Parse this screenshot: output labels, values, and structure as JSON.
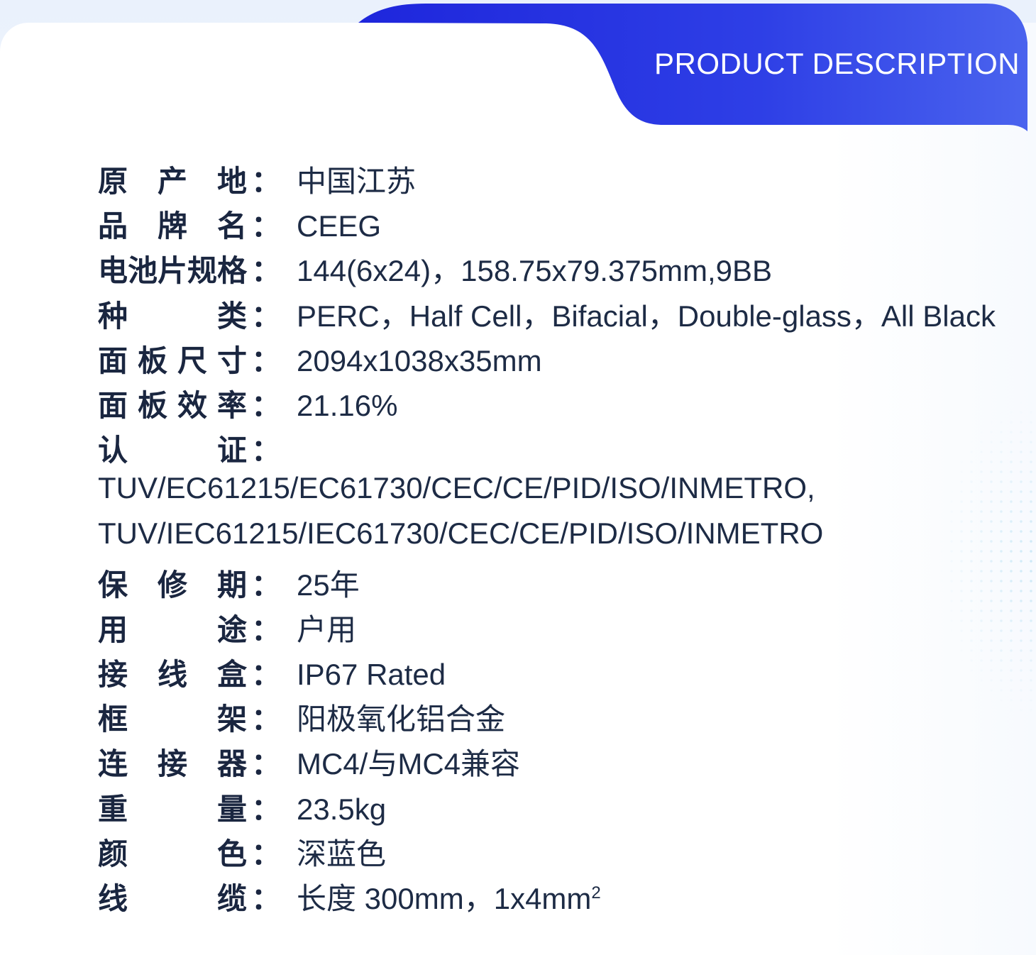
{
  "header": {
    "title": "PRODUCT DESCRIPTION",
    "banner_color": "#2a34e0"
  },
  "specs": [
    {
      "label_chars": [
        "原",
        "产",
        "地"
      ],
      "value": "中国江苏"
    },
    {
      "label_chars": [
        "品",
        "牌",
        "名"
      ],
      "value": "CEEG"
    },
    {
      "label_chars": [
        "电",
        "池",
        "片",
        "规",
        "格"
      ],
      "value": "144(6x24)，158.75x79.375mm,9BB"
    },
    {
      "label_chars": [
        "种",
        "类"
      ],
      "value": "PERC，Half Cell，Bifacial，Double-glass，All Black"
    },
    {
      "label_chars": [
        "面",
        "板",
        "尺",
        "寸"
      ],
      "value": "2094x1038x35mm"
    },
    {
      "label_chars": [
        "面",
        "板",
        "效",
        "率"
      ],
      "value": "21.16%"
    },
    {
      "label_chars": [
        "认",
        "证"
      ],
      "value": ""
    }
  ],
  "certifications": [
    "TUV/EC61215/EC61730/CEC/CE/PID/ISO/INMETRO,",
    "TUV/IEC61215/IEC61730/CEC/CE/PID/ISO/INMETRO"
  ],
  "specs2": [
    {
      "label_chars": [
        "保",
        "修",
        "期"
      ],
      "value": "25年"
    },
    {
      "label_chars": [
        "用",
        "途"
      ],
      "value": "户用"
    },
    {
      "label_chars": [
        "接",
        "线",
        "盒"
      ],
      "value": "IP67 Rated"
    },
    {
      "label_chars": [
        "框",
        "架"
      ],
      "value": "阳极氧化铝合金"
    },
    {
      "label_chars": [
        "连",
        "接",
        "器"
      ],
      "value": "MC4/与MC4兼容"
    },
    {
      "label_chars": [
        "重",
        "量"
      ],
      "value": "23.5kg"
    },
    {
      "label_chars": [
        "颜",
        "色"
      ],
      "value": "深蓝色"
    },
    {
      "label_chars": [
        "线",
        "缆"
      ],
      "value": "长度 300mm，1x4mm",
      "superscript": "2"
    }
  ],
  "colon": "："
}
